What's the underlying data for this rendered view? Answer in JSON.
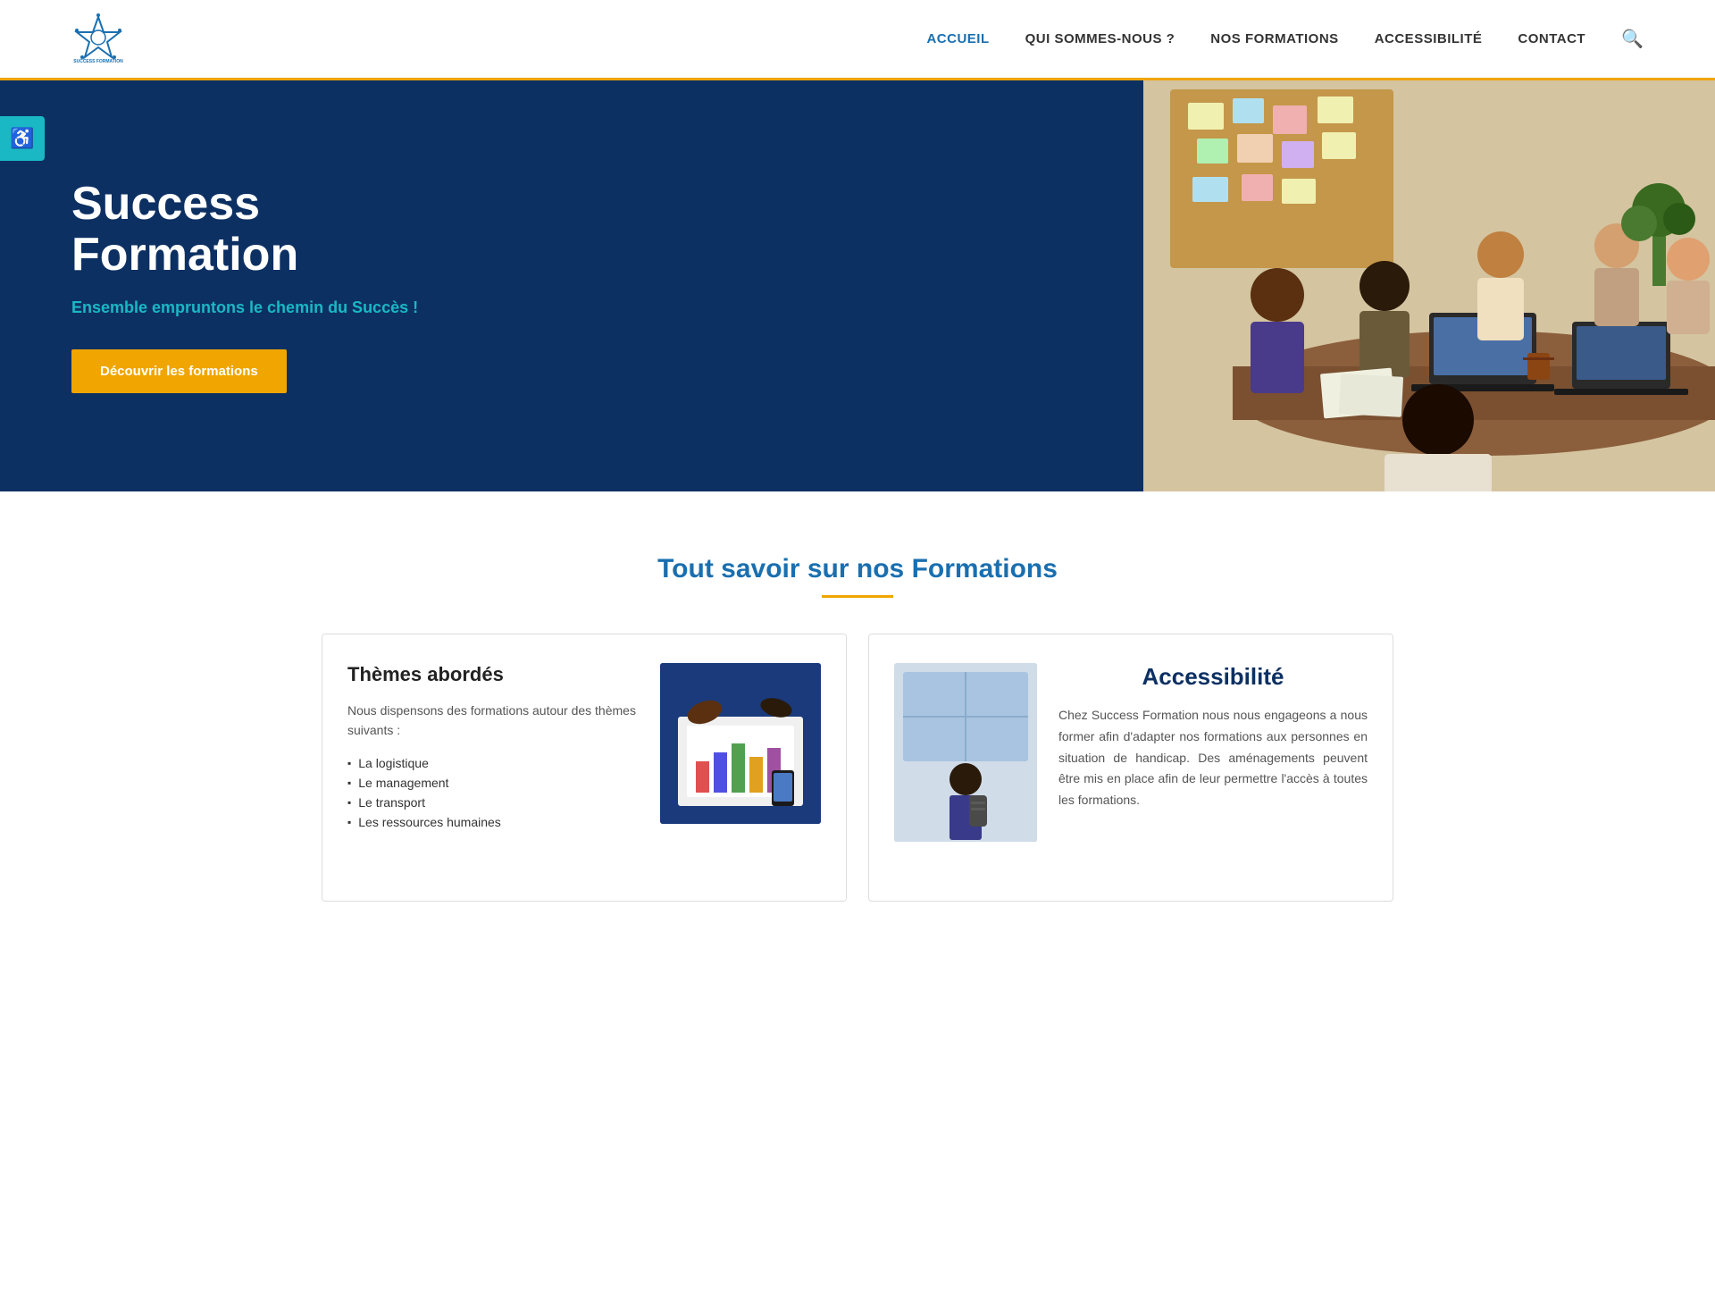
{
  "header": {
    "logo_alt": "Success Formation",
    "nav": {
      "items": [
        {
          "label": "ACCUEIL",
          "active": true
        },
        {
          "label": "QUI SOMMES-NOUS ?",
          "active": false
        },
        {
          "label": "NOS FORMATIONS",
          "active": false
        },
        {
          "label": "ACCESSIBILITÉ",
          "active": false
        },
        {
          "label": "CONTACT",
          "active": false
        }
      ]
    },
    "search_aria": "Rechercher"
  },
  "hero": {
    "title": "Success Formation",
    "subtitle": "Ensemble empruntons le chemin du Succès !",
    "cta_label": "Découvrir les formations",
    "image_alt": "Équipe en réunion"
  },
  "accessibility_btn": {
    "label": "♿",
    "aria": "Accessibilité"
  },
  "formations": {
    "section_title": "Tout savoir sur nos Formations",
    "card_themes": {
      "title": "Thèmes abordés",
      "description": "Nous dispensons des formations autour des thèmes suivants :",
      "list": [
        "La logistique",
        "Le management",
        "Le transport",
        "Les ressources humaines"
      ],
      "image_alt": "Analyse de données"
    },
    "card_accessibility": {
      "title": "Accessibilité",
      "body": "Chez Success Formation nous nous engageons a nous former afin d'adapter nos formations aux personnes en situation de handicap. Des aménagements peuvent être mis en place afin de leur permettre l'accès à toutes les formations.",
      "image_alt": "Personne en formation"
    }
  }
}
